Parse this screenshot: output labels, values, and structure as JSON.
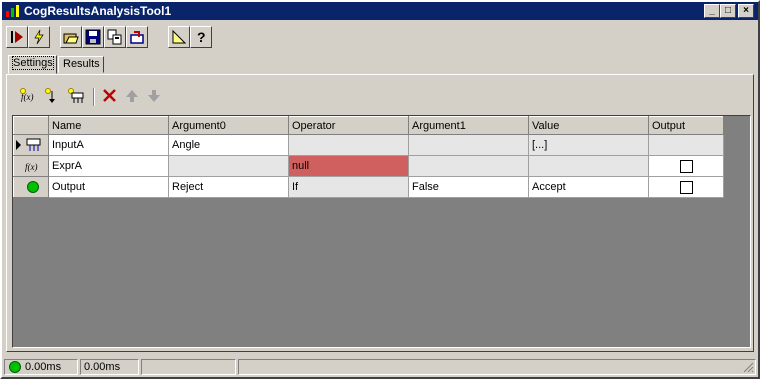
{
  "window": {
    "title": "CogResultsAnalysisTool1"
  },
  "tabs": [
    {
      "label": "Settings"
    },
    {
      "label": "Results"
    }
  ],
  "grid": {
    "columns": [
      "Name",
      "Argument0",
      "Operator",
      "Argument1",
      "Value",
      "Output"
    ],
    "rows": [
      {
        "icon": "input-icon",
        "name": "InputA",
        "arg0": "Angle",
        "operator": "",
        "arg1": "",
        "value": "[...]"
      },
      {
        "icon": "function-icon",
        "name": "ExprA",
        "arg0": "",
        "operator": "null",
        "arg1": "",
        "value": ""
      },
      {
        "icon": "green-status-icon",
        "name": "Output",
        "arg0": "Reject",
        "operator": "If",
        "arg1": "False",
        "value": "Accept"
      }
    ]
  },
  "status": {
    "time1": "0.00ms",
    "time2": "0.00ms"
  },
  "colors": {
    "title_bg": "#0a246a",
    "error_cell": "#d06060",
    "status_ok": "#00c000"
  }
}
